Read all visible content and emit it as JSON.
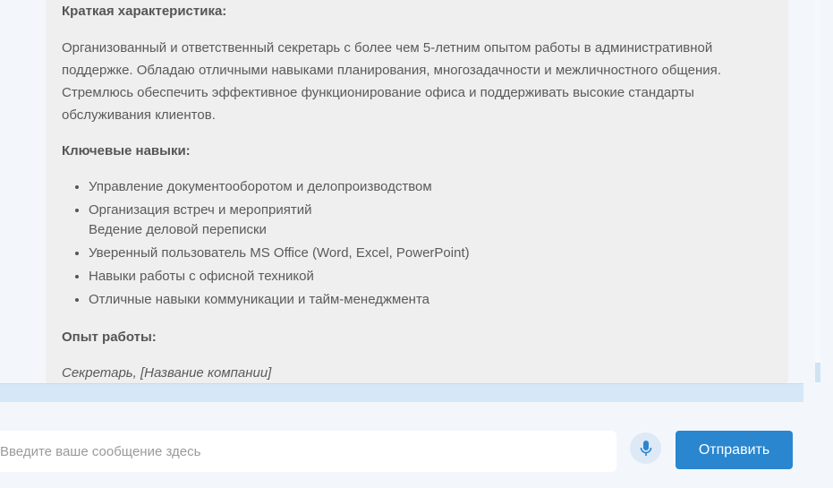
{
  "message": {
    "summary_title": "Краткая характеристика:",
    "summary_text": "Организованный и ответственный секретарь с более чем 5-летним опытом работы в административной поддержке. Обладаю отличными навыками планирования, многозадачности и межличностного общения. Стремлюсь обеспечить эффективное функционирование офиса и поддерживать высокие стандарты обслуживания клиентов.",
    "skills_title": "Ключевые навыки:",
    "skills": [
      "Управление документооборотом и делопроизводством",
      "Организация встреч и мероприятий",
      "Ведение деловой переписки",
      "Уверенный пользователь MS Office (Word, Excel, PowerPoint)",
      "Навыки работы с офисной техникой",
      "Отличные навыки коммуникации и тайм-менеджмента"
    ],
    "experience_title": "Опыт работы:",
    "experience_position": "Секретарь, [Название компании]"
  },
  "composer": {
    "placeholder": "Введите ваше сообщение здесь",
    "mic_icon": "microphone-icon",
    "send_label": "Отправить"
  },
  "colors": {
    "accent": "#2986cf",
    "card_bg": "#efefef",
    "page_bg": "#f3f7fb"
  }
}
